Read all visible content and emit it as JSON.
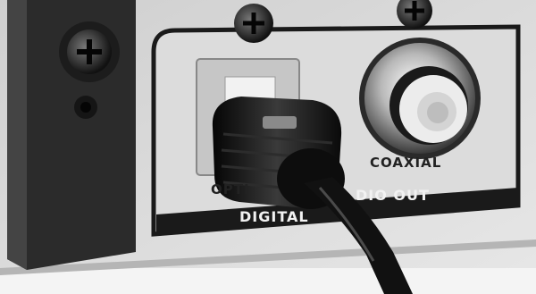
{
  "photo": {
    "description_labels": {
      "optical_text": "OPTI",
      "coaxial_text": "COAXIAL",
      "section_left_text": "DIGITAL",
      "section_right_text": "DIO OUT"
    },
    "colors": {
      "panel": "#d7d7d7",
      "dark_strip": "#2b2b2b",
      "plate_band": "#1a1a1a",
      "connector": "#151515",
      "rca_center": "#e8e8e8"
    }
  }
}
